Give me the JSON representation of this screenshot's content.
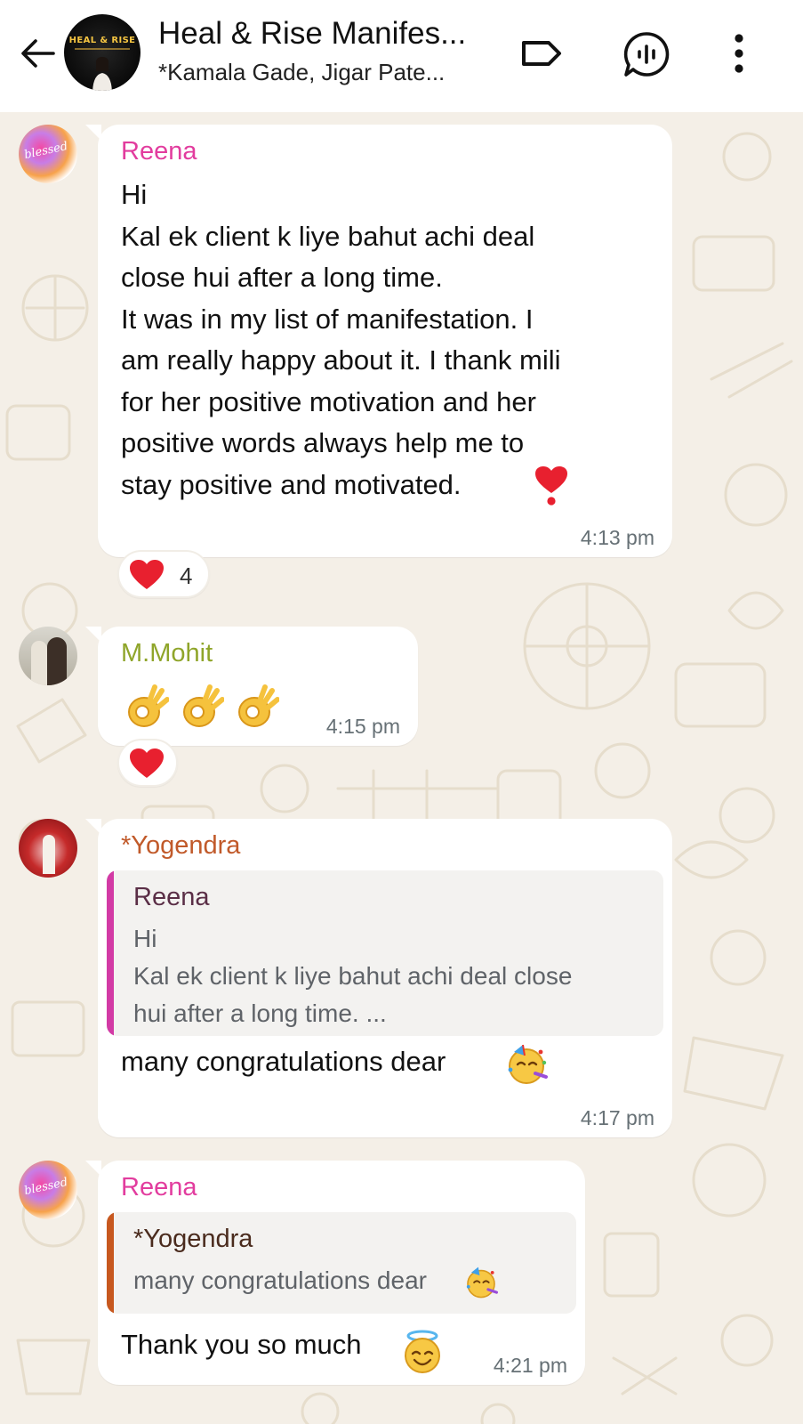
{
  "header": {
    "title": "Heal & Rise Manifes...",
    "subtitle": "*Kamala Gade, Jigar Pate...",
    "avatar_text": "HEAL & RISE",
    "icons": {
      "back": "arrow-left-icon",
      "label": "label-tag-icon",
      "voice_chat": "voice-chat-icon",
      "more": "more-vertical-icon"
    }
  },
  "colors": {
    "reena": "#e23c9e",
    "mohit": "#8fa52a",
    "yogendra": "#c15a2a",
    "bubble": "#ffffff",
    "chat_bg": "#f4efe7",
    "quote_bg": "#f3f2f0",
    "quote_reena_bar": "#d23aa5",
    "quote_yogendra_bar": "#c7581f",
    "time_text": "#667075"
  },
  "messages": [
    {
      "sender": "Reena",
      "text": "Hi\nKal ek client k liye bahut achi deal\nclose hui after a long time.\nIt was in my list of manifestation. I\nam really happy about it. I thank mili\nfor her positive motivation and her\npositive words always help me to\nstay positive and motivated.",
      "trailing_emoji": "heart-exclamation-emoji",
      "time": "4:13 pm",
      "reaction": {
        "emoji": "red-heart-emoji",
        "count": "4"
      },
      "avatar_text": "blessed"
    },
    {
      "sender": "M.Mohit",
      "emojis": [
        "ok-hand-emoji",
        "ok-hand-emoji",
        "ok-hand-emoji"
      ],
      "time": "4:15 pm",
      "reaction": {
        "emoji": "red-heart-emoji"
      }
    },
    {
      "sender": "*Yogendra",
      "quote": {
        "sender": "Reena",
        "text": "Hi\nKal ek client k liye bahut achi deal close\nhui after a long time. ..."
      },
      "text": "many congratulations dear",
      "trailing_emoji": "partying-face-emoji",
      "time": "4:17 pm"
    },
    {
      "sender": "Reena",
      "quote": {
        "sender": "*Yogendra",
        "text": "many congratulations dear"
      },
      "quote_emoji": "partying-face-emoji",
      "text": "Thank you so much",
      "trailing_emoji": "smiling-face-with-halo-emoji",
      "time": "4:21 pm",
      "avatar_text": "blessed"
    }
  ]
}
